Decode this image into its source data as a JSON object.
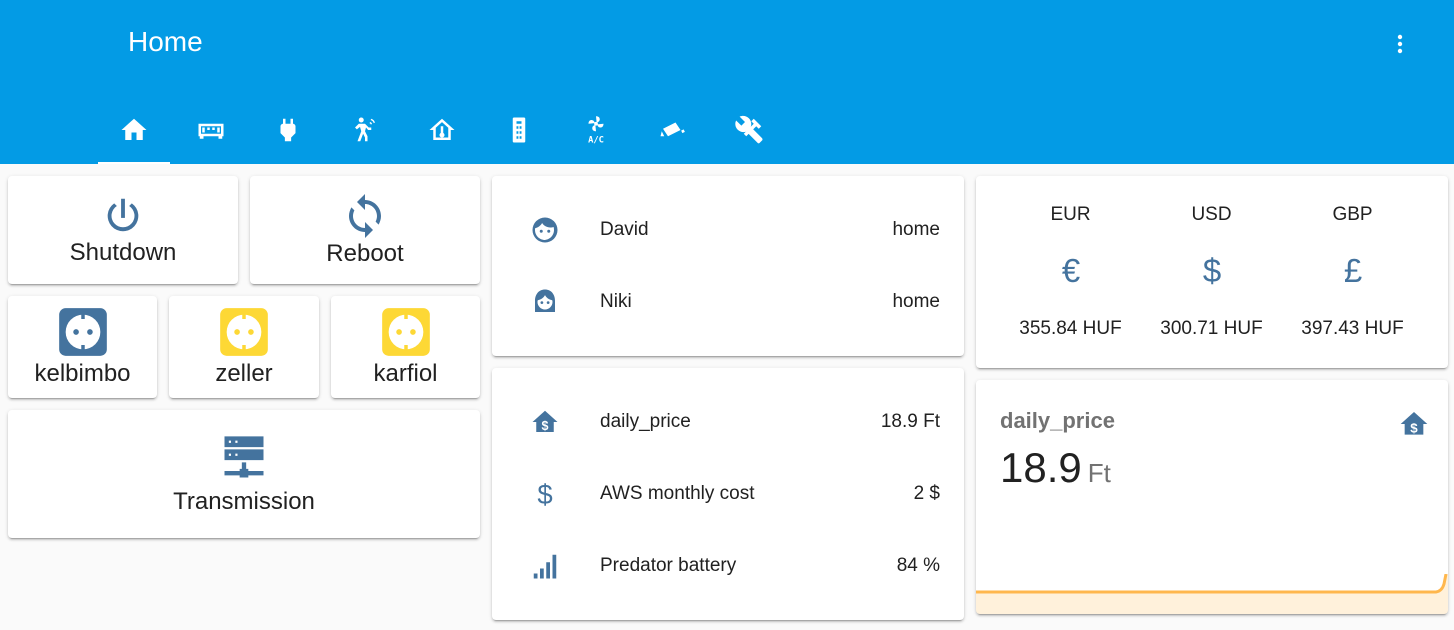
{
  "header": {
    "title": "Home",
    "tabs": [
      {
        "icon": "home-icon",
        "active": true
      },
      {
        "icon": "router-device-icon",
        "active": false
      },
      {
        "icon": "power-plug-icon",
        "active": false
      },
      {
        "icon": "motion-sensor-icon",
        "active": false
      },
      {
        "icon": "home-thermometer-icon",
        "active": false
      },
      {
        "icon": "remote-icon",
        "active": false
      },
      {
        "icon": "air-conditioner-icon",
        "active": false
      },
      {
        "icon": "security-camera-icon",
        "active": false
      },
      {
        "icon": "tools-icon",
        "active": false
      }
    ],
    "menu_icon": "dots-vertical-icon"
  },
  "buttons": {
    "shutdown": "Shutdown",
    "reboot": "Reboot",
    "kelbimbo": "kelbimbo",
    "zeller": "zeller",
    "karfiol": "karfiol",
    "transmission": "Transmission"
  },
  "people": [
    {
      "name": "David",
      "state": "home",
      "icon": "face-man-icon"
    },
    {
      "name": "Niki",
      "state": "home",
      "icon": "face-woman-icon"
    }
  ],
  "sensors": [
    {
      "name": "daily_price",
      "value": "18.9 Ft",
      "icon": "home-currency-icon"
    },
    {
      "name": "AWS monthly cost",
      "value": "2 $",
      "icon": "dollar-icon"
    },
    {
      "name": "Predator battery",
      "value": "84 %",
      "icon": "signal-bars-icon"
    }
  ],
  "currencies": [
    {
      "code": "EUR",
      "rate": "355.84 HUF",
      "icon": "euro-icon"
    },
    {
      "code": "USD",
      "rate": "300.71 HUF",
      "icon": "dollar-icon"
    },
    {
      "code": "GBP",
      "rate": "397.43 HUF",
      "icon": "pound-icon"
    }
  ],
  "sensor_card": {
    "name": "daily_price",
    "value": "18.9",
    "unit": "Ft",
    "icon": "home-currency-icon"
  },
  "colors": {
    "header": "#039be5",
    "icon": "#44739e",
    "outlet_on": "#fdd835",
    "graph": "#ffb74d"
  }
}
